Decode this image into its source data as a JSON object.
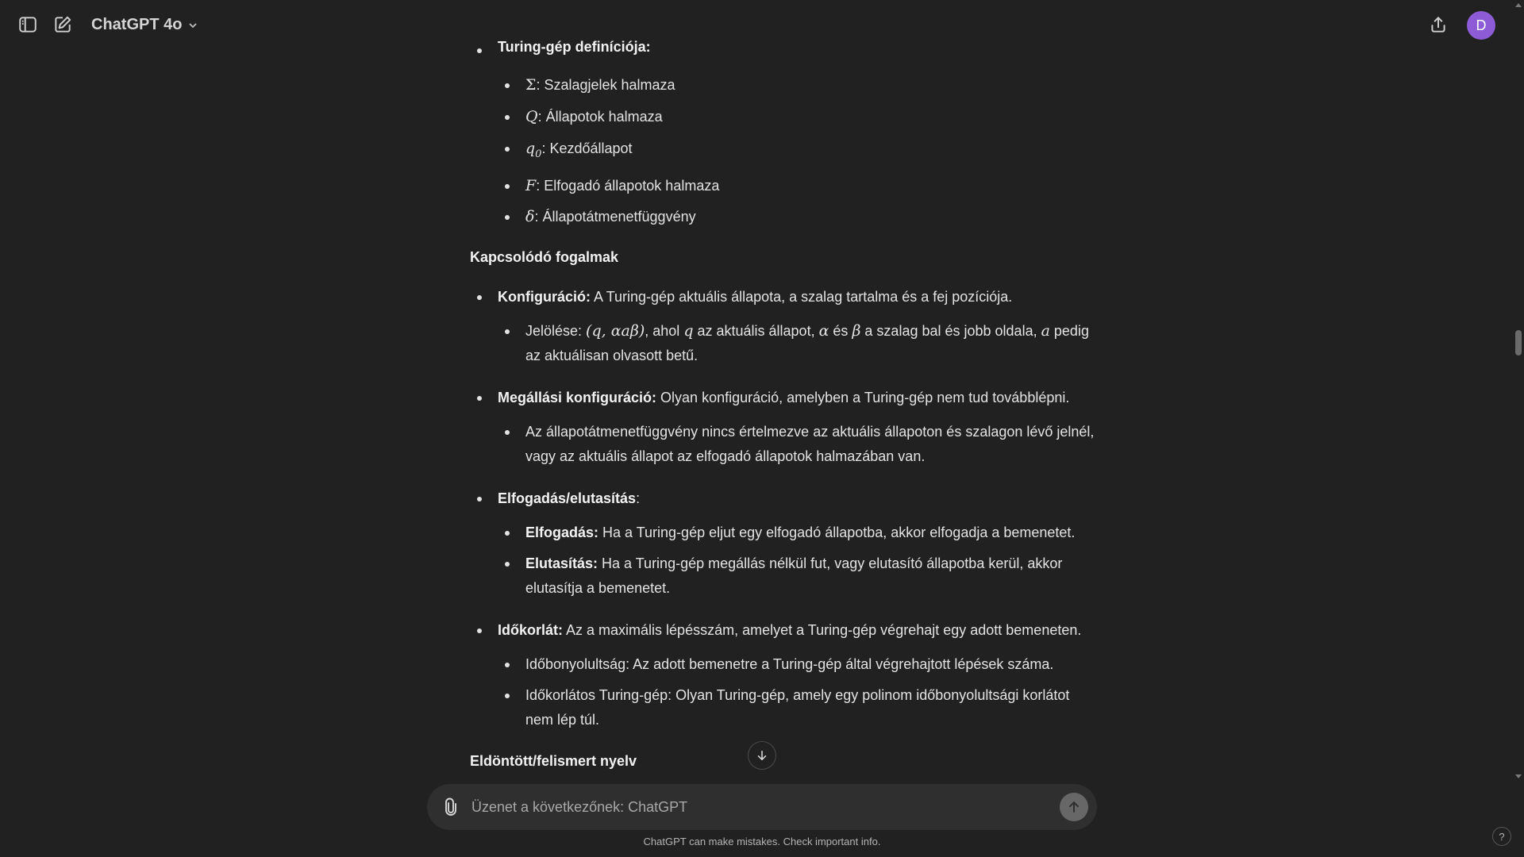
{
  "header": {
    "model_name": "ChatGPT 4o",
    "avatar_letter": "D"
  },
  "content": {
    "tm_def_label": "Turing-gép definíciója:",
    "tm_def_items": [
      {
        "sym": "Σ",
        "text": ": Szalagjelek halmaza"
      },
      {
        "sym": "Q",
        "text": ": Állapotok halmaza"
      },
      {
        "sym": "q",
        "sub": "0",
        "text": ": Kezdőállapot"
      },
      {
        "sym": "F",
        "text": ": Elfogadó állapotok halmaza"
      },
      {
        "sym": "δ",
        "text": ": Állapotátmenetfüggvény"
      }
    ],
    "heading_related": "Kapcsolódó fogalmak",
    "config": {
      "label": "Konfiguráció:",
      "text": " A Turing-gép aktuális állapota, a szalag tartalma és a fej pozíciója.",
      "sub_prefix": "Jelölése: ",
      "sub_math": "(q, αaβ)",
      "sub_t1": ", ahol ",
      "sub_m1": "q",
      "sub_t2": " az aktuális állapot, ",
      "sub_m2": "α",
      "sub_t3": " és ",
      "sub_m3": "β",
      "sub_t4": " a szalag bal és jobb oldala, ",
      "sub_m4": "a",
      "sub_t5": " pedig az aktuálisan olvasott betű."
    },
    "halt": {
      "label": "Megállási konfiguráció:",
      "text": " Olyan konfiguráció, amelyben a Turing-gép nem tud továbblépni.",
      "sub": "Az állapotátmenetfüggvény nincs értelmezve az aktuális állapoton és szalagon lévő jelnél, vagy az aktuális állapot az elfogadó állapotok halmazában van."
    },
    "accept": {
      "label": "Elfogadás/elutasítás",
      "colon": ":",
      "accept_label": "Elfogadás:",
      "accept_text": " Ha a Turing-gép eljut egy elfogadó állapotba, akkor elfogadja a bemenetet.",
      "reject_label": "Elutasítás:",
      "reject_text": " Ha a Turing-gép megállás nélkül fut, vagy elutasító állapotba kerül, akkor elutasítja a bemenetet."
    },
    "time": {
      "label": "Időkorlát:",
      "text": " Az a maximális lépésszám, amelyet a Turing-gép végrehajt egy adott bemeneten.",
      "sub1": "Időbonyolultság: Az adott bemenetre a Turing-gép által végrehajtott lépések száma.",
      "sub2": "Időkorlátos Turing-gép: Olyan Turing-gép, amely egy polinom időbonyolultsági korlátot nem lép túl."
    },
    "heading_decided": "Eldöntött/felismert nyelv"
  },
  "composer": {
    "placeholder": "Üzenet a következőnek: ChatGPT"
  },
  "footer": {
    "disclaimer": "ChatGPT can make mistakes. Check important info.",
    "help": "?"
  }
}
